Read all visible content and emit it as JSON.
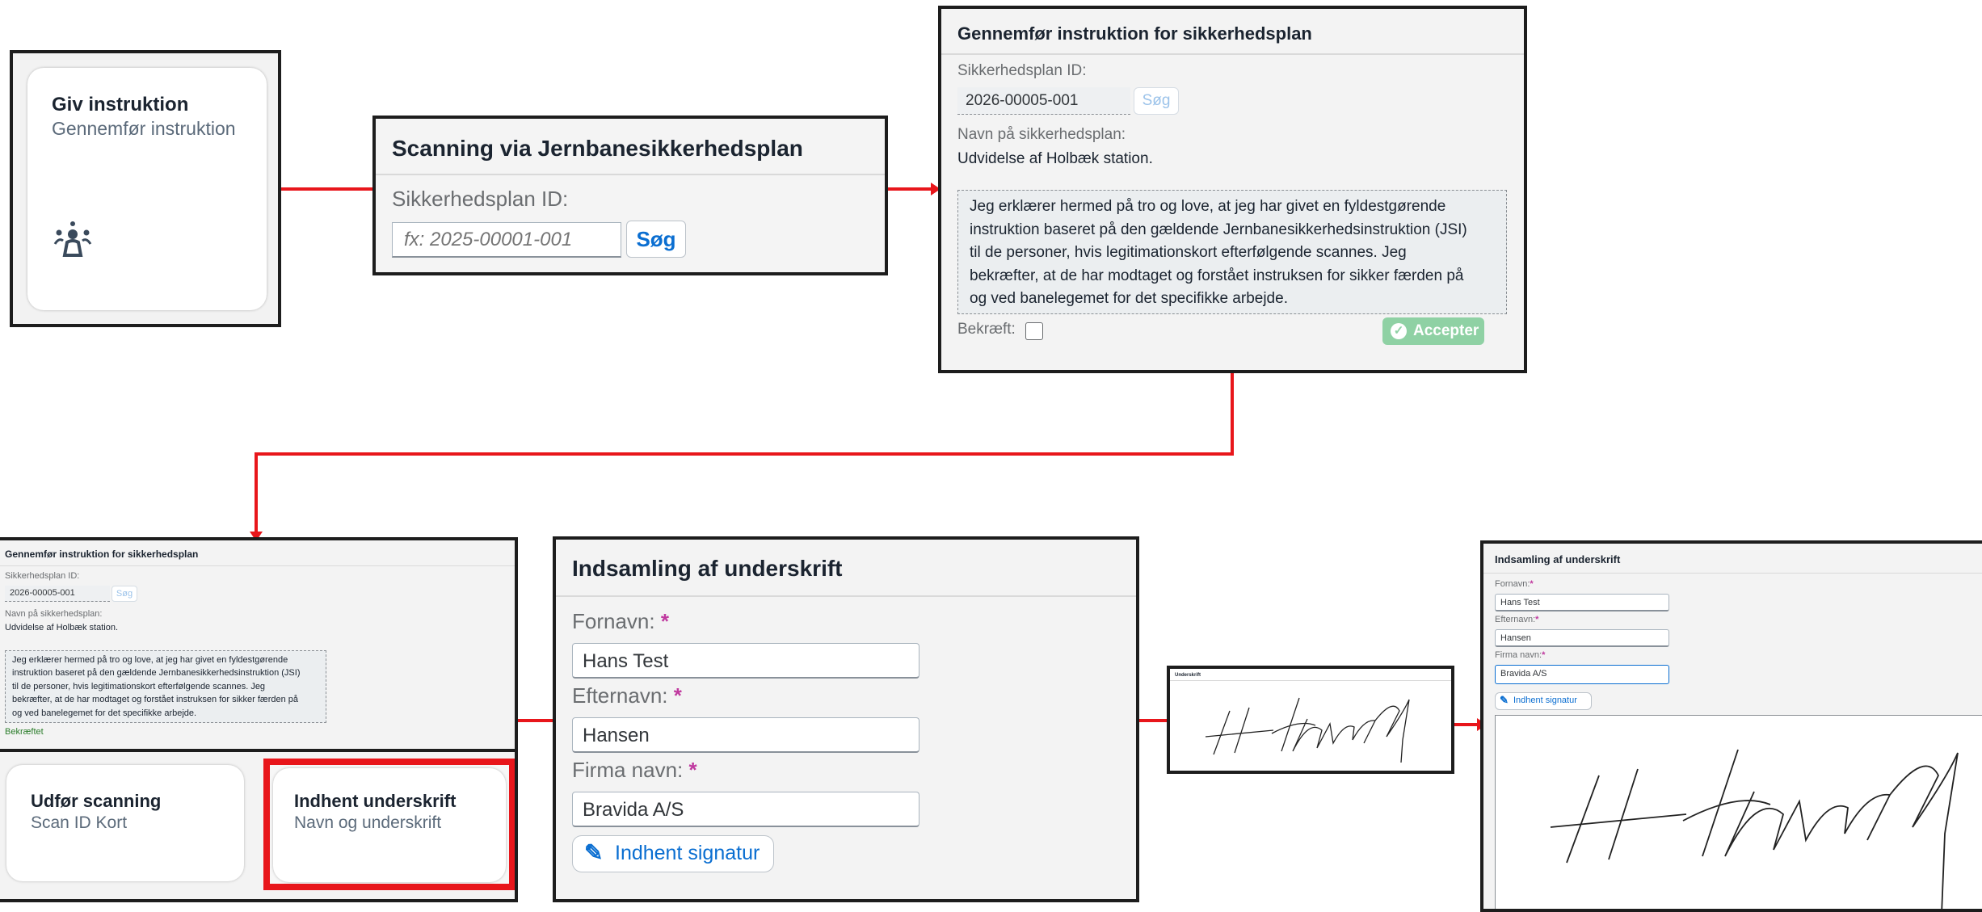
{
  "colors": {
    "connector": "#e8161b",
    "accent": "#0a6ed1",
    "required": "#c0399f",
    "accept": "#70c08b",
    "confirmed": "#2b7d2b"
  },
  "tile_instruction": {
    "title": "Giv instruktion",
    "subtitle": "Gennemfør instruktion",
    "icon": "group-instruction-icon"
  },
  "scan_panel": {
    "title": "Scanning via Jernbanesikkerhedsplan",
    "id_label": "Sikkerhedsplan ID:",
    "id_placeholder": "fx: 2025-00001-001",
    "search_label": "Søg"
  },
  "instruct_panel": {
    "title": "Gennemfør instruktion for sikkerhedsplan",
    "id_label": "Sikkerhedsplan ID:",
    "id_value": "2026-00005-001",
    "search_label": "Søg",
    "name_label": "Navn på sikkerhedsplan:",
    "name_value": "Udvidelse af Holbæk station.",
    "declaration_lines": [
      "Jeg erklærer hermed på tro og love, at jeg har givet en fyldestgørende",
      "instruktion baseret på den gældende Jernbanesikkerhedsinstruktion (JSI)",
      "til de personer, hvis legitimationskort efterfølgende scannes. Jeg",
      "bekræfter, at de har modtaget og forstået instruksen for sikker færden på",
      "og ved banelegemet for det specifikke arbejde."
    ],
    "confirm_label": "Bekræft:",
    "accept_label": "Accepter",
    "confirmed_label": "Bekræftet"
  },
  "action_tiles": [
    {
      "title": "Udfør scanning",
      "subtitle": "Scan ID Kort"
    },
    {
      "title": "Indhent underskrift",
      "subtitle": "Navn og underskrift"
    }
  ],
  "signature_form": {
    "title": "Indsamling af underskrift",
    "first_name_label": "Fornavn:",
    "first_name_value": "Hans Test",
    "last_name_label": "Efternavn:",
    "last_name_value": "Hansen",
    "company_label": "Firma navn:",
    "company_value": "Bravida A/S",
    "collect_button": "Indhent signatur",
    "required_mark": "*"
  },
  "signature_preview": {
    "title": "Underskrift"
  }
}
